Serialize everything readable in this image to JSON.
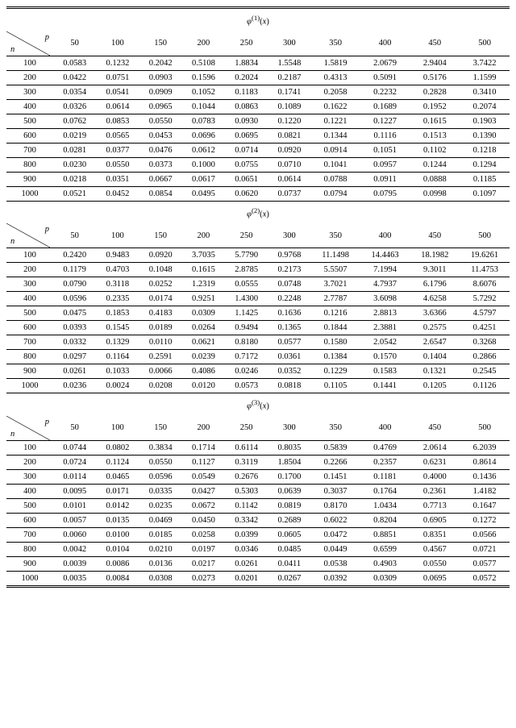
{
  "sections": [
    {
      "title": "φ⁽¹⁾(x)",
      "cols": [
        "50",
        "100",
        "150",
        "200",
        "250",
        "300",
        "350",
        "400",
        "450",
        "500"
      ],
      "rows": [
        {
          "n": "100",
          "v": [
            "0.0583",
            "0.1232",
            "0.2042",
            "0.5108",
            "1.8834",
            "1.5548",
            "1.5819",
            "2.0679",
            "2.9404",
            "3.7422"
          ]
        },
        {
          "n": "200",
          "v": [
            "0.0422",
            "0.0751",
            "0.0903",
            "0.1596",
            "0.2024",
            "0.2187",
            "0.4313",
            "0.5091",
            "0.5176",
            "1.1599"
          ]
        },
        {
          "n": "300",
          "v": [
            "0.0354",
            "0.0541",
            "0.0909",
            "0.1052",
            "0.1183",
            "0.1741",
            "0.2058",
            "0.2232",
            "0.2828",
            "0.3410"
          ]
        },
        {
          "n": "400",
          "v": [
            "0.0326",
            "0.0614",
            "0.0965",
            "0.1044",
            "0.0863",
            "0.1089",
            "0.1622",
            "0.1689",
            "0.1952",
            "0.2074"
          ]
        },
        {
          "n": "500",
          "v": [
            "0.0762",
            "0.0853",
            "0.0550",
            "0.0783",
            "0.0930",
            "0.1220",
            "0.1221",
            "0.1227",
            "0.1615",
            "0.1903"
          ]
        },
        {
          "n": "600",
          "v": [
            "0.0219",
            "0.0565",
            "0.0453",
            "0.0696",
            "0.0695",
            "0.0821",
            "0.1344",
            "0.1116",
            "0.1513",
            "0.1390"
          ]
        },
        {
          "n": "700",
          "v": [
            "0.0281",
            "0.0377",
            "0.0476",
            "0.0612",
            "0.0714",
            "0.0920",
            "0.0914",
            "0.1051",
            "0.1102",
            "0.1218"
          ]
        },
        {
          "n": "800",
          "v": [
            "0.0230",
            "0.0550",
            "0.0373",
            "0.1000",
            "0.0755",
            "0.0710",
            "0.1041",
            "0.0957",
            "0.1244",
            "0.1294"
          ]
        },
        {
          "n": "900",
          "v": [
            "0.0218",
            "0.0351",
            "0.0667",
            "0.0617",
            "0.0651",
            "0.0614",
            "0.0788",
            "0.0911",
            "0.0888",
            "0.1185"
          ]
        },
        {
          "n": "1000",
          "v": [
            "0.0521",
            "0.0452",
            "0.0854",
            "0.0495",
            "0.0620",
            "0.0737",
            "0.0794",
            "0.0795",
            "0.0998",
            "0.1097"
          ]
        }
      ]
    },
    {
      "title": "φ⁽²⁾(x)",
      "cols": [
        "50",
        "100",
        "150",
        "200",
        "250",
        "300",
        "350",
        "400",
        "450",
        "500"
      ],
      "rows": [
        {
          "n": "100",
          "v": [
            "0.2420",
            "0.9483",
            "0.0920",
            "3.7035",
            "5.7790",
            "0.9768",
            "11.1498",
            "14.4463",
            "18.1982",
            "19.6261"
          ]
        },
        {
          "n": "200",
          "v": [
            "0.1179",
            "0.4703",
            "0.1048",
            "0.1615",
            "2.8785",
            "0.2173",
            "5.5507",
            "7.1994",
            "9.3011",
            "11.4753"
          ]
        },
        {
          "n": "300",
          "v": [
            "0.0790",
            "0.3118",
            "0.0252",
            "1.2319",
            "0.0555",
            "0.0748",
            "3.7021",
            "4.7937",
            "6.1796",
            "8.6076"
          ]
        },
        {
          "n": "400",
          "v": [
            "0.0596",
            "0.2335",
            "0.0174",
            "0.9251",
            "1.4300",
            "0.2248",
            "2.7787",
            "3.6098",
            "4.6258",
            "5.7292"
          ]
        },
        {
          "n": "500",
          "v": [
            "0.0475",
            "0.1853",
            "0.4183",
            "0.0309",
            "1.1425",
            "0.1636",
            "0.1216",
            "2.8813",
            "3.6366",
            "4.5797"
          ]
        },
        {
          "n": "600",
          "v": [
            "0.0393",
            "0.1545",
            "0.0189",
            "0.0264",
            "0.9494",
            "0.1365",
            "0.1844",
            "2.3881",
            "0.2575",
            "0.4251"
          ]
        },
        {
          "n": "700",
          "v": [
            "0.0332",
            "0.1329",
            "0.0110",
            "0.0621",
            "0.8180",
            "0.0577",
            "0.1580",
            "2.0542",
            "2.6547",
            "0.3268"
          ]
        },
        {
          "n": "800",
          "v": [
            "0.0297",
            "0.1164",
            "0.2591",
            "0.0239",
            "0.7172",
            "0.0361",
            "0.1384",
            "0.1570",
            "0.1404",
            "0.2866"
          ]
        },
        {
          "n": "900",
          "v": [
            "0.0261",
            "0.1033",
            "0.0066",
            "0.4086",
            "0.0246",
            "0.0352",
            "0.1229",
            "0.1583",
            "0.1321",
            "0.2545"
          ]
        },
        {
          "n": "1000",
          "v": [
            "0.0236",
            "0.0024",
            "0.0208",
            "0.0120",
            "0.0573",
            "0.0818",
            "0.1105",
            "0.1441",
            "0.1205",
            "0.1126"
          ]
        }
      ]
    },
    {
      "title": "φ⁽³⁾(x)",
      "cols": [
        "50",
        "100",
        "150",
        "200",
        "250",
        "300",
        "350",
        "400",
        "450",
        "500"
      ],
      "rows": [
        {
          "n": "100",
          "v": [
            "0.0744",
            "0.0802",
            "0.3834",
            "0.1714",
            "0.6114",
            "0.8035",
            "0.5839",
            "0.4769",
            "2.0614",
            "6.2039"
          ]
        },
        {
          "n": "200",
          "v": [
            "0.0724",
            "0.1124",
            "0.0550",
            "0.1127",
            "0.3119",
            "1.8504",
            "0.2266",
            "0.2357",
            "0.6231",
            "0.8614"
          ]
        },
        {
          "n": "300",
          "v": [
            "0.0114",
            "0.0465",
            "0.0596",
            "0.0549",
            "0.2676",
            "0.1700",
            "0.1451",
            "0.1181",
            "0.4000",
            "0.1436"
          ]
        },
        {
          "n": "400",
          "v": [
            "0.0095",
            "0.0171",
            "0.0335",
            "0.0427",
            "0.5303",
            "0.0639",
            "0.3037",
            "0.1764",
            "0.2361",
            "1.4182"
          ]
        },
        {
          "n": "500",
          "v": [
            "0.0101",
            "0.0142",
            "0.0235",
            "0.0672",
            "0.1142",
            "0.0819",
            "0.8170",
            "1.0434",
            "0.7713",
            "0.1647"
          ]
        },
        {
          "n": "600",
          "v": [
            "0.0057",
            "0.0135",
            "0.0469",
            "0.0450",
            "0.3342",
            "0.2689",
            "0.6022",
            "0.8204",
            "0.6905",
            "0.1272"
          ]
        },
        {
          "n": "700",
          "v": [
            "0.0060",
            "0.0100",
            "0.0185",
            "0.0258",
            "0.0399",
            "0.0605",
            "0.0472",
            "0.8851",
            "0.8351",
            "0.0566"
          ]
        },
        {
          "n": "800",
          "v": [
            "0.0042",
            "0.0104",
            "0.0210",
            "0.0197",
            "0.0346",
            "0.0485",
            "0.0449",
            "0.6599",
            "0.4567",
            "0.0721"
          ]
        },
        {
          "n": "900",
          "v": [
            "0.0039",
            "0.0086",
            "0.0136",
            "0.0217",
            "0.0261",
            "0.0411",
            "0.0538",
            "0.4903",
            "0.0550",
            "0.0577"
          ]
        },
        {
          "n": "1000",
          "v": [
            "0.0035",
            "0.0084",
            "0.0308",
            "0.0273",
            "0.0201",
            "0.0267",
            "0.0392",
            "0.0309",
            "0.0695",
            "0.0572"
          ]
        }
      ]
    }
  ],
  "corner": {
    "p": "p",
    "n": "n"
  }
}
